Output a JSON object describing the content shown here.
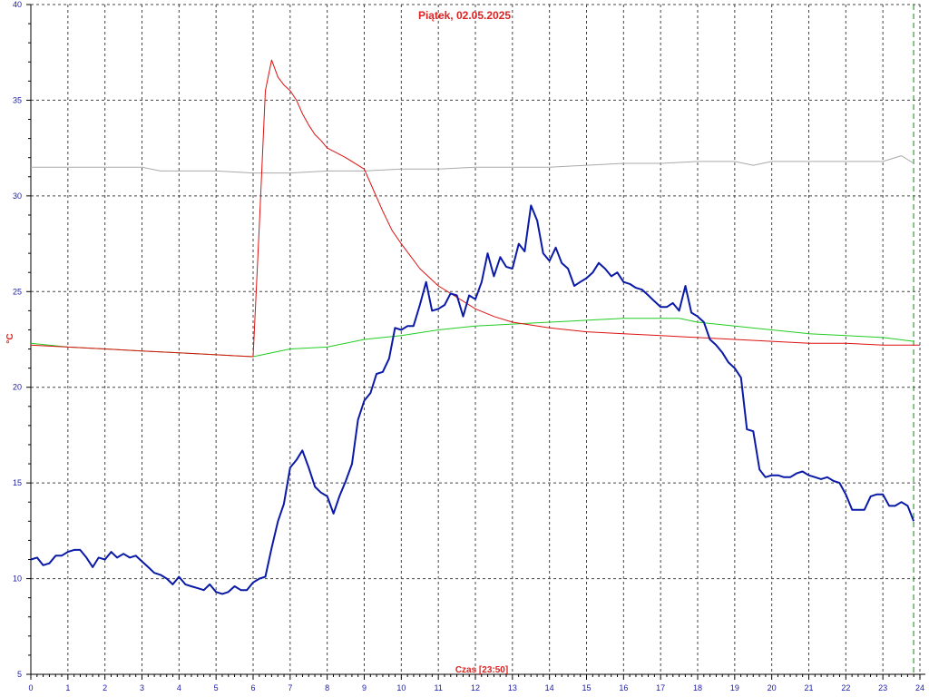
{
  "chart_data": {
    "type": "line",
    "title": "Piątek, 02.05.2025",
    "xlabel": "Czas [23:50]",
    "ylabel": "°C",
    "xlim": [
      0,
      24
    ],
    "ylim": [
      5,
      40
    ],
    "x_ticks": [
      0,
      1,
      2,
      3,
      4,
      5,
      6,
      7,
      8,
      9,
      10,
      11,
      12,
      13,
      14,
      15,
      16,
      17,
      18,
      19,
      20,
      21,
      22,
      23,
      24
    ],
    "y_ticks": [
      5,
      10,
      15,
      20,
      25,
      30,
      35,
      40
    ],
    "grid": true,
    "current_time_marker": 23.83,
    "series": [
      {
        "color": "#0a1aa6",
        "x": [
          0,
          0.17,
          0.33,
          0.5,
          0.67,
          0.83,
          1,
          1.17,
          1.33,
          1.5,
          1.67,
          1.83,
          2,
          2.17,
          2.33,
          2.5,
          2.67,
          2.83,
          3,
          3.17,
          3.33,
          3.5,
          3.67,
          3.83,
          4,
          4.17,
          4.33,
          4.5,
          4.67,
          4.83,
          5,
          5.17,
          5.33,
          5.5,
          5.67,
          5.83,
          6,
          6.17,
          6.33,
          6.5,
          6.67,
          6.83,
          7,
          7.17,
          7.33,
          7.5,
          7.67,
          7.83,
          8,
          8.17,
          8.33,
          8.5,
          8.67,
          8.83,
          9,
          9.17,
          9.33,
          9.5,
          9.67,
          9.83,
          10,
          10.17,
          10.33,
          10.5,
          10.67,
          10.83,
          11,
          11.17,
          11.33,
          11.5,
          11.67,
          11.83,
          12,
          12.17,
          12.33,
          12.5,
          12.67,
          12.83,
          13,
          13.17,
          13.33,
          13.5,
          13.67,
          13.83,
          14,
          14.17,
          14.33,
          14.5,
          14.67,
          14.83,
          15,
          15.17,
          15.33,
          15.5,
          15.67,
          15.83,
          16,
          16.17,
          16.33,
          16.5,
          16.67,
          16.83,
          17,
          17.17,
          17.33,
          17.5,
          17.67,
          17.83,
          18,
          18.17,
          18.33,
          18.5,
          18.67,
          18.83,
          19,
          19.17,
          19.33,
          19.5,
          19.67,
          19.83,
          20,
          20.17,
          20.33,
          20.5,
          20.67,
          20.83,
          21,
          21.17,
          21.33,
          21.5,
          21.67,
          21.83,
          22,
          22.17,
          22.33,
          22.5,
          22.67,
          22.83,
          23,
          23.17,
          23.33,
          23.5,
          23.67,
          23.83
        ],
        "values": [
          11.0,
          11.1,
          10.7,
          10.8,
          11.2,
          11.2,
          11.4,
          11.5,
          11.5,
          11.1,
          10.6,
          11.1,
          11.0,
          11.4,
          11.1,
          11.3,
          11.1,
          11.2,
          10.9,
          10.6,
          10.3,
          10.2,
          10.0,
          9.7,
          10.1,
          9.7,
          9.6,
          9.5,
          9.4,
          9.7,
          9.3,
          9.2,
          9.3,
          9.6,
          9.4,
          9.4,
          9.8,
          10.0,
          10.1,
          11.6,
          13.0,
          13.9,
          15.8,
          16.2,
          16.7,
          15.8,
          14.8,
          14.5,
          14.3,
          13.4,
          14.3,
          15.1,
          16.0,
          18.3,
          19.3,
          19.7,
          20.7,
          20.8,
          21.5,
          23.1,
          23.0,
          23.2,
          23.2,
          24.3,
          25.5,
          24.0,
          24.1,
          24.3,
          24.9,
          24.8,
          23.7,
          24.8,
          24.6,
          25.5,
          27.0,
          25.8,
          26.8,
          26.3,
          26.2,
          27.5,
          27.1,
          29.5,
          28.7,
          27.0,
          26.6,
          27.3,
          26.5,
          26.2,
          25.3,
          25.5,
          25.7,
          26.0,
          26.5,
          26.2,
          25.8,
          26.0,
          25.5,
          25.4,
          25.2,
          25.1,
          24.8,
          24.5,
          24.2,
          24.2,
          24.4,
          24.0,
          25.3,
          23.9,
          23.7,
          23.4,
          22.5,
          22.2,
          21.8,
          21.3,
          21.0,
          20.5,
          17.8,
          17.7,
          15.7,
          15.3,
          15.4,
          15.4,
          15.3,
          15.3,
          15.5,
          15.6,
          15.4,
          15.3,
          15.2,
          15.3,
          15.1,
          15.0,
          14.4,
          13.6,
          13.6,
          13.6,
          14.3,
          14.4,
          14.4,
          13.8,
          13.8,
          14.0,
          13.8,
          13.0
        ]
      },
      {
        "color": "#dd1111",
        "x": [
          0,
          1,
          2,
          3,
          4,
          5,
          6,
          6.17,
          6.33,
          6.5,
          6.67,
          6.83,
          7,
          7.17,
          7.33,
          7.5,
          7.67,
          7.83,
          8,
          8.5,
          9,
          9.25,
          9.5,
          9.75,
          10,
          10.5,
          11,
          11.5,
          12,
          12.5,
          13,
          14,
          15,
          16,
          17,
          18,
          19,
          20,
          21,
          22,
          23,
          24
        ],
        "values": [
          22.2,
          22.1,
          22.0,
          21.9,
          21.8,
          21.7,
          21.6,
          28.5,
          35.5,
          37.1,
          36.2,
          35.8,
          35.5,
          35.0,
          34.3,
          33.7,
          33.2,
          32.9,
          32.5,
          32.0,
          31.4,
          30.3,
          29.2,
          28.2,
          27.5,
          26.2,
          25.3,
          24.7,
          24.1,
          23.7,
          23.4,
          23.1,
          22.9,
          22.8,
          22.7,
          22.6,
          22.5,
          22.4,
          22.3,
          22.3,
          22.2,
          22.2
        ]
      },
      {
        "color": "#22cc22",
        "x": [
          0,
          1,
          2,
          3,
          4,
          5,
          6,
          6.5,
          7,
          8,
          9,
          10,
          11,
          12,
          13,
          14,
          15,
          16,
          17,
          17.5,
          18,
          19,
          20,
          21,
          22,
          23,
          23.83
        ],
        "values": [
          22.3,
          22.1,
          22.0,
          21.9,
          21.8,
          21.7,
          21.6,
          21.8,
          22.0,
          22.1,
          22.5,
          22.7,
          23.0,
          23.2,
          23.3,
          23.4,
          23.5,
          23.6,
          23.6,
          23.6,
          23.4,
          23.2,
          23.0,
          22.8,
          22.7,
          22.6,
          22.4
        ]
      },
      {
        "color": "#aaaaaa",
        "x": [
          0,
          1,
          2,
          3,
          3.5,
          4,
          5,
          6,
          7,
          8,
          9,
          10,
          11,
          12,
          13,
          14,
          15,
          16,
          17,
          18,
          19,
          19.5,
          20,
          21,
          22,
          23,
          23.5,
          23.83
        ],
        "values": [
          31.5,
          31.5,
          31.5,
          31.5,
          31.3,
          31.3,
          31.3,
          31.2,
          31.2,
          31.3,
          31.3,
          31.4,
          31.4,
          31.5,
          31.5,
          31.5,
          31.6,
          31.7,
          31.7,
          31.8,
          31.8,
          31.6,
          31.8,
          31.8,
          31.8,
          31.8,
          32.1,
          31.7
        ]
      }
    ]
  }
}
